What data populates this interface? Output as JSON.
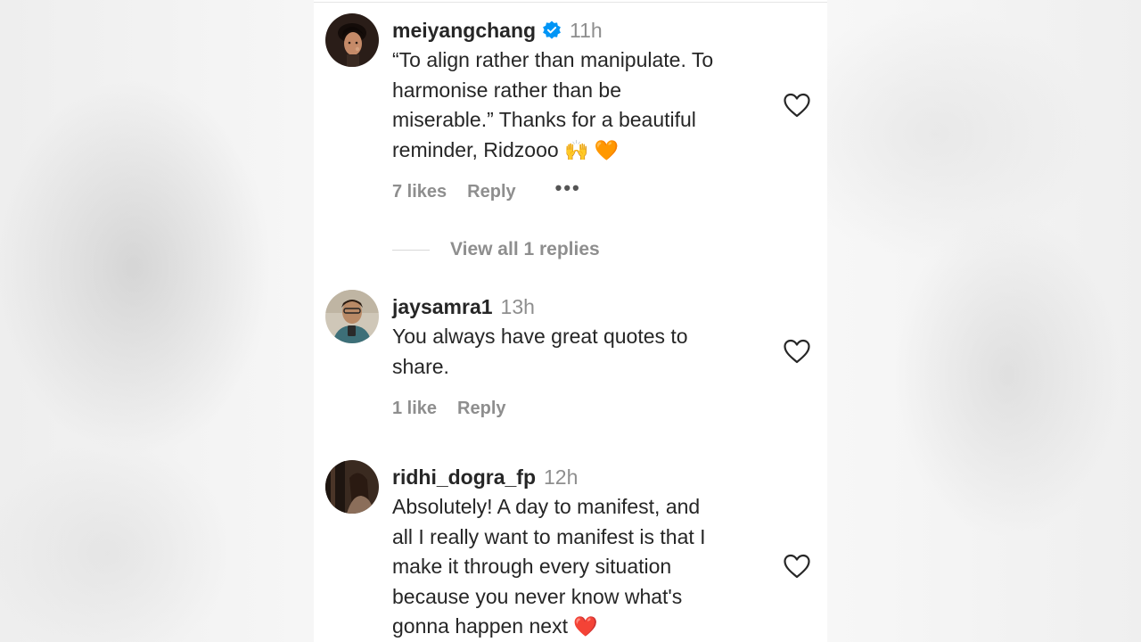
{
  "comments": [
    {
      "username": "meiyangchang",
      "verified": true,
      "time": "11h",
      "text": "“To align rather than manipulate. To\nharmonise rather than be\nmiserable.” Thanks for a beautiful\nreminder, Ridzooo",
      "emojis": [
        "🙌",
        "🧡"
      ],
      "likes": "7 likes",
      "reply_label": "Reply",
      "more_label": "•••",
      "view_replies": "View all 1 replies"
    },
    {
      "username": "jaysamra1",
      "verified": false,
      "time": "13h",
      "text": "You always have great quotes to\nshare.",
      "likes": "1 like",
      "reply_label": "Reply"
    },
    {
      "username": "ridhi_dogra_fp",
      "verified": false,
      "time": "12h",
      "text": "Absolutely! A day to manifest, and\nall I really want to manifest is that I\nmake it through every situation\nbecause you never know what's\ngonna happen next",
      "emojis": [
        "❤️"
      ]
    }
  ],
  "colors": {
    "verified_blue": "#0095f6",
    "primary_text": "#262626",
    "secondary_text": "#8e8e8e"
  },
  "icons": {
    "like": "heart-outline-icon",
    "verified": "verified-badge-icon"
  }
}
